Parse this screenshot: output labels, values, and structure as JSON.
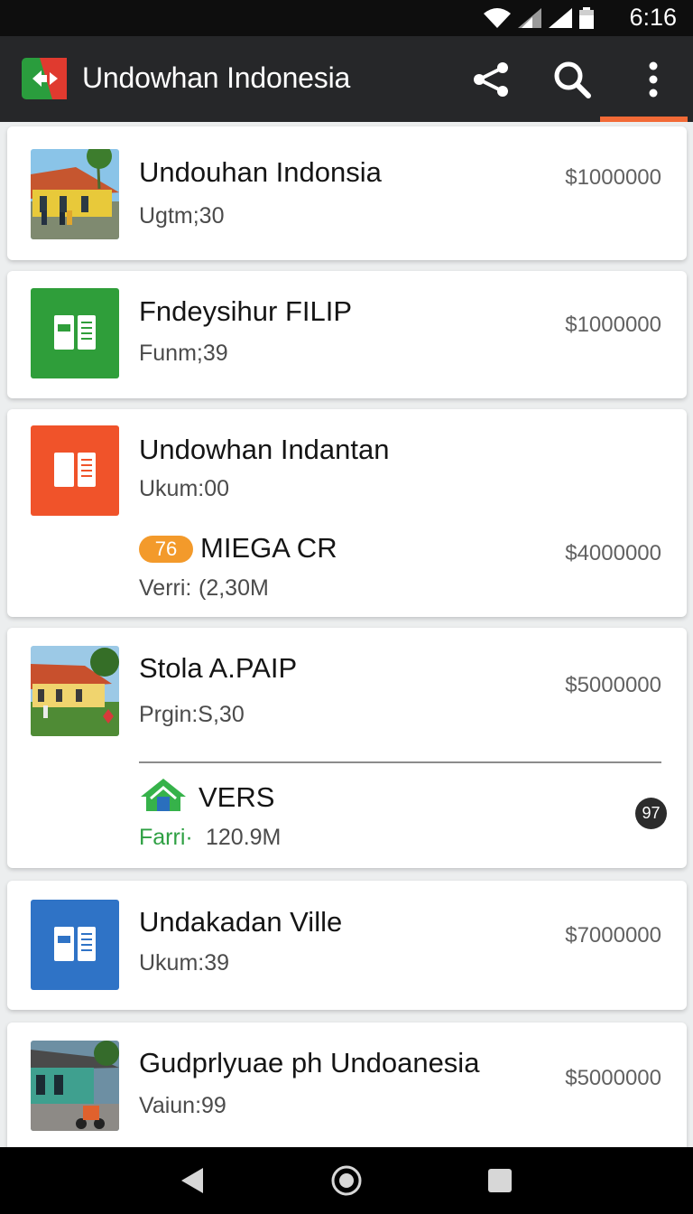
{
  "status_bar": {
    "time": "6:16",
    "icons": [
      "wifi-icon",
      "signal-icon",
      "signal-icon",
      "battery-icon"
    ]
  },
  "app_bar": {
    "title": "Undowhan Indonesia",
    "actions": [
      "share-icon",
      "search-icon",
      "overflow-menu-icon"
    ],
    "accent": "#f26a36"
  },
  "items": [
    {
      "title": "Undouhan Indonsia",
      "subtitle": "Ugtm;30",
      "price": "$​1000000",
      "thumb": "photo"
    },
    {
      "title": "Fndeysihur FILIP",
      "subtitle": "Funm;39",
      "price": "$​1000000",
      "thumb": "green-doc"
    },
    {
      "title": "Undowhan Indantan",
      "subtitle": "Ukum:00",
      "thumb": "orange-doc",
      "extra": {
        "badge": "76",
        "name": "MIEGA CR",
        "sub_label": "Verri:",
        "sub_value": "(2,30M",
        "price": "$4000000"
      }
    },
    {
      "title": "Stola A.PAIP",
      "subtitle": "Prgin:S,30",
      "price": "$5000000",
      "thumb": "photo",
      "extra": {
        "name": "VERS",
        "sub_label": "Farri·",
        "sub_value": "120.9M",
        "count": "97"
      }
    },
    {
      "title": "Undakadan Ville",
      "subtitle": "Ukum:39",
      "price": "$7000000",
      "thumb": "blue-doc"
    },
    {
      "title": "Gudprlyuae ph Undoanesia",
      "subtitle": "Vaiun:99",
      "price": "$5000000",
      "thumb": "photo"
    }
  ],
  "nav_bar": {
    "buttons": [
      "back-icon",
      "home-icon",
      "recents-icon"
    ]
  }
}
